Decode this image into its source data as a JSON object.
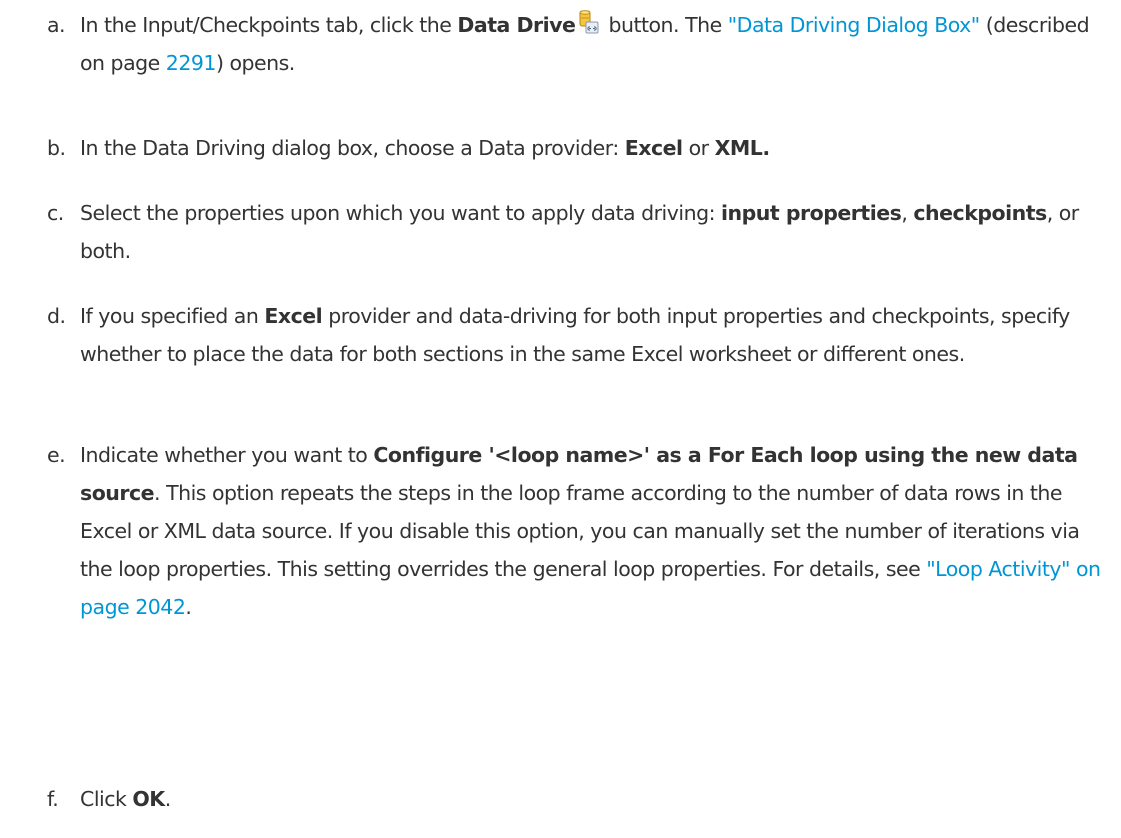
{
  "steps": [
    {
      "marker": "a.",
      "t1": "In the Input/Checkpoints tab, click the ",
      "b1": "Data Drive",
      "icon": "data-drive-icon",
      "t2": " button. The ",
      "link1": "\"Data Driving Dialog Box\"",
      "t3": " (described on page ",
      "link2": "2291",
      "t4": ") opens."
    },
    {
      "marker": "b.",
      "t1": "In the Data Driving dialog box, choose a Data provider: ",
      "b1": "Excel",
      "t2": " or ",
      "b2": "XML."
    },
    {
      "marker": "c.",
      "t1": "Select the properties upon which you want to apply data driving: ",
      "b1": "input properties",
      "t2": ", ",
      "b2": "checkpoints",
      "t3": ", or both."
    },
    {
      "marker": "d.",
      "t1": "If you specified an ",
      "b1": "Excel",
      "t2": " provider and data-driving for both input properties and checkpoints, specify whether to place the data for both sections in the same Excel worksheet or different ones."
    },
    {
      "marker": "e.",
      "t1": "Indicate whether you want to ",
      "b1": "Configure '<loop name>' as a For Each loop using the new data source",
      "t2": ". This option repeats the steps in the loop frame according to the number of data rows in the Excel or XML data source. If you disable this option, you can manually set the number of iterations via the loop properties. This setting overrides the general loop properties. For details, see ",
      "link1": "\"Loop Activity\" on page 2042",
      "t3": "."
    },
    {
      "marker": "f.",
      "t1": "Click ",
      "b1": "OK",
      "t2": "."
    }
  ]
}
